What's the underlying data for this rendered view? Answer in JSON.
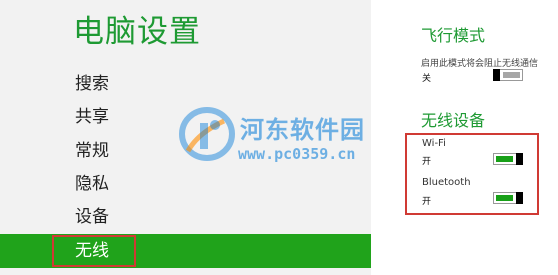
{
  "left": {
    "title": "电脑设置",
    "nav": [
      {
        "label": "搜索",
        "selected": false
      },
      {
        "label": "共享",
        "selected": false
      },
      {
        "label": "常规",
        "selected": false
      },
      {
        "label": "隐私",
        "selected": false
      },
      {
        "label": "设备",
        "selected": false
      },
      {
        "label": "无线",
        "selected": true
      }
    ]
  },
  "right": {
    "airplane": {
      "title": "飞行模式",
      "description": "启用此模式将会阻止无线通信",
      "state_label": "关",
      "state": "off"
    },
    "wireless": {
      "title": "无线设备",
      "devices": [
        {
          "name": "Wi-Fi",
          "state_label": "开",
          "state": "on"
        },
        {
          "name": "Bluetooth",
          "state_label": "开",
          "state": "on"
        }
      ]
    }
  },
  "watermark": {
    "text": "河东软件园",
    "url": "www.pc0359.cn"
  },
  "colors": {
    "accent_green": "#1e9a33",
    "selected_bg": "#20a31b",
    "highlight_red": "#d03a34"
  }
}
